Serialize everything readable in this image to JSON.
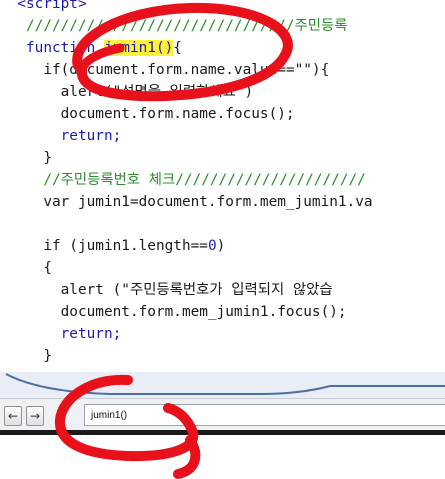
{
  "editor": {
    "lines": [
      {
        "tokens": [
          {
            "t": "  <script>",
            "c": "tag"
          }
        ]
      },
      {
        "tokens": [
          {
            "t": "   ///////////////////////////////주민등록",
            "c": "cm"
          }
        ]
      },
      {
        "tokens": [
          {
            "t": "   function ",
            "c": "kw"
          },
          {
            "t": "jumin1()",
            "c": "hl"
          },
          {
            "t": "{",
            "c": "txt"
          }
        ]
      },
      {
        "tokens": [
          {
            "t": "     if(document.form.name.value==\"\"){",
            "c": "txt"
          }
        ]
      },
      {
        "tokens": [
          {
            "t": "       alert(\"성명을 입력하세요\")",
            "c": "txt"
          }
        ]
      },
      {
        "tokens": [
          {
            "t": "       document.form.name.focus();",
            "c": "txt"
          }
        ]
      },
      {
        "tokens": [
          {
            "t": "       return;",
            "c": "kw"
          }
        ]
      },
      {
        "tokens": [
          {
            "t": "     }",
            "c": "txt"
          }
        ]
      },
      {
        "tokens": [
          {
            "t": "     //주민등록번호 체크//////////////////////",
            "c": "cm"
          }
        ]
      },
      {
        "tokens": [
          {
            "t": "     var jumin1=document.form.mem_jumin1.va",
            "c": "txt"
          }
        ]
      },
      {
        "tokens": [
          {
            "t": "",
            "c": "txt"
          }
        ]
      },
      {
        "tokens": [
          {
            "t": "     if (jumin1.length==",
            "c": "txt"
          },
          {
            "t": "0",
            "c": "num"
          },
          {
            "t": ")",
            "c": "txt"
          }
        ]
      },
      {
        "tokens": [
          {
            "t": "     {",
            "c": "txt"
          }
        ]
      },
      {
        "tokens": [
          {
            "t": "       alert (\"주민등록번호가 입력되지 않았습",
            "c": "txt"
          }
        ]
      },
      {
        "tokens": [
          {
            "t": "       document.form.mem_jumin1.focus();",
            "c": "txt"
          }
        ]
      },
      {
        "tokens": [
          {
            "t": "       return;",
            "c": "kw"
          }
        ]
      },
      {
        "tokens": [
          {
            "t": "     }",
            "c": "txt"
          }
        ]
      }
    ]
  },
  "toolbar": {
    "back_label": "←",
    "forward_label": "→",
    "find_value": "jumin1()"
  },
  "colors": {
    "annotation": "#e8101a",
    "highlight": "#fff03a",
    "keyword": "#1a1ab0",
    "comment": "#2e8b2e"
  }
}
